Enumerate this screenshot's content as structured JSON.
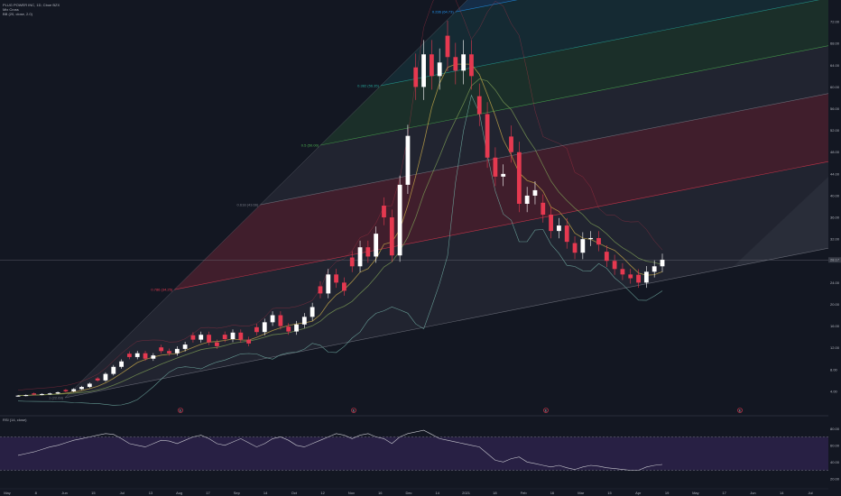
{
  "header": {
    "title": "PLUG POWER INC, 1D, Cboe BZX",
    "indicator1": "Mix Cross",
    "indicator2": "BB (20, close, 2.0)",
    "rsi_label": "RSI (14, close)"
  },
  "colors": {
    "background": "#131722",
    "up": "#ffffff",
    "down": "#e53950",
    "bb": "#6fa8a0",
    "ma_fast": "#c6a94a",
    "ma_slow": "#7a9a55",
    "rsi_line": "#c8c8d0",
    "rsi_band": "#3a2860"
  },
  "price_axis": {
    "ticks": [
      "72.00",
      "68.00",
      "64.00",
      "60.00",
      "56.00",
      "52.00",
      "48.00",
      "44.00",
      "40.00",
      "36.00",
      "32.00",
      "28.00",
      "24.00",
      "20.00",
      "16.00",
      "12.00",
      "8.00",
      "4.00"
    ],
    "current_price": "28.17"
  },
  "time_axis": {
    "labels": [
      "May",
      "8",
      "Jun",
      "15",
      "Jul",
      "13",
      "Aug",
      "17",
      "Sep",
      "14",
      "Oct",
      "12",
      "Nov",
      "16",
      "Dec",
      "14",
      "2021",
      "18",
      "Feb",
      "16",
      "Mar",
      "15",
      "Apr",
      "19",
      "May",
      "17",
      "Jun",
      "14",
      "Jul"
    ]
  },
  "rsi_axis": {
    "ticks": [
      "80.00",
      "60.00",
      "40.00",
      "20.00"
    ]
  },
  "fib_levels": [
    {
      "ratio": 0,
      "label": "0 (72.00)",
      "color": "#787b86"
    },
    {
      "ratio": 0.236,
      "label": "0.236 (64.73)",
      "color": "#2196f3"
    },
    {
      "ratio": 0.382,
      "label": "0.382 (56.35)",
      "color": "#26a69a"
    },
    {
      "ratio": 0.5,
      "label": "0.5 (50.00)",
      "color": "#4caf50"
    },
    {
      "ratio": 0.618,
      "label": "0.618 (43.66)",
      "color": "#787b86"
    },
    {
      "ratio": 0.786,
      "label": "0.786 (34.25)",
      "color": "#e53950"
    },
    {
      "ratio": 1,
      "label": "1 (22.69)",
      "color": "#787b86"
    }
  ],
  "event_markers": [
    "E",
    "E",
    "E",
    "E"
  ],
  "chart_data": {
    "type": "candlestick",
    "title": "PLUG POWER INC, 1D, Cboe BZX",
    "ylim": [
      0,
      76
    ],
    "closes": [
      3.2,
      3.3,
      3.4,
      3.5,
      3.6,
      3.8,
      4.0,
      4.4,
      4.8,
      5.4,
      6.0,
      7.2,
      8.5,
      9.5,
      10.3,
      11.0,
      10.0,
      10.6,
      11.4,
      11.0,
      11.8,
      12.6,
      13.5,
      14.4,
      13.0,
      12.3,
      13.6,
      14.8,
      13.5,
      12.8,
      14.9,
      16.7,
      18.0,
      16.0,
      15.0,
      16.3,
      17.7,
      19.5,
      22.0,
      25.5,
      24.0,
      22.5,
      27.0,
      30.5,
      28.8,
      33.0,
      36.0,
      29.0,
      42.0,
      51.0,
      60.0,
      66.0,
      62.0,
      64.5,
      65.5,
      63.0,
      66.0,
      62.0,
      55.0,
      47.0,
      43.5,
      44.0,
      48.0,
      38.5,
      40.0,
      41.0,
      36.5,
      33.5,
      34.5,
      31.5,
      29.5,
      32.0,
      32.2,
      31.0,
      28.0,
      26.5,
      25.5,
      24.8,
      24.0,
      26.0,
      27.0,
      28.2
    ]
  },
  "rsi_data": {
    "values": [
      48,
      50,
      52,
      55,
      58,
      60,
      63,
      66,
      68,
      70,
      72,
      74,
      73,
      68,
      62,
      60,
      58,
      62,
      66,
      65,
      62,
      66,
      70,
      72,
      68,
      62,
      60,
      64,
      68,
      63,
      58,
      62,
      68,
      70,
      66,
      60,
      58,
      62,
      66,
      70,
      74,
      72,
      68,
      72,
      74,
      70,
      68,
      62,
      70,
      74,
      76,
      78,
      73,
      68,
      66,
      64,
      62,
      60,
      58,
      50,
      42,
      40,
      44,
      46,
      40,
      38,
      36,
      34,
      36,
      33,
      31,
      34,
      36,
      35,
      33,
      32,
      31,
      30,
      30,
      34,
      36,
      37
    ]
  }
}
